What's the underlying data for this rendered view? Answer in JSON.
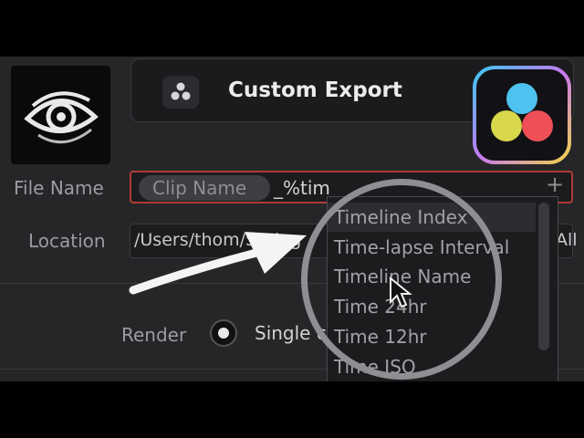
{
  "preset": {
    "title": "Custom Export"
  },
  "file_name": {
    "label": "File Name",
    "chip": "Clip Name",
    "typed": "_%tim",
    "add": "+"
  },
  "location": {
    "label": "Location",
    "value": "/Users/thom/Spring",
    "trail": "All"
  },
  "render": {
    "label": "Render",
    "option": "Single c",
    "trail": "s"
  },
  "dropdown": {
    "items": [
      "Timeline Index",
      "Time-lapse Interval",
      "Timeline Name",
      "Time 24hr",
      "Time 12hr",
      "Time ISO"
    ],
    "highlighted_index": 0
  },
  "colors": {
    "accent_red": "#b13a36",
    "resolve_blue": "#4fc3f0",
    "resolve_red": "#ef4f56",
    "resolve_yellow": "#d8d84a"
  }
}
